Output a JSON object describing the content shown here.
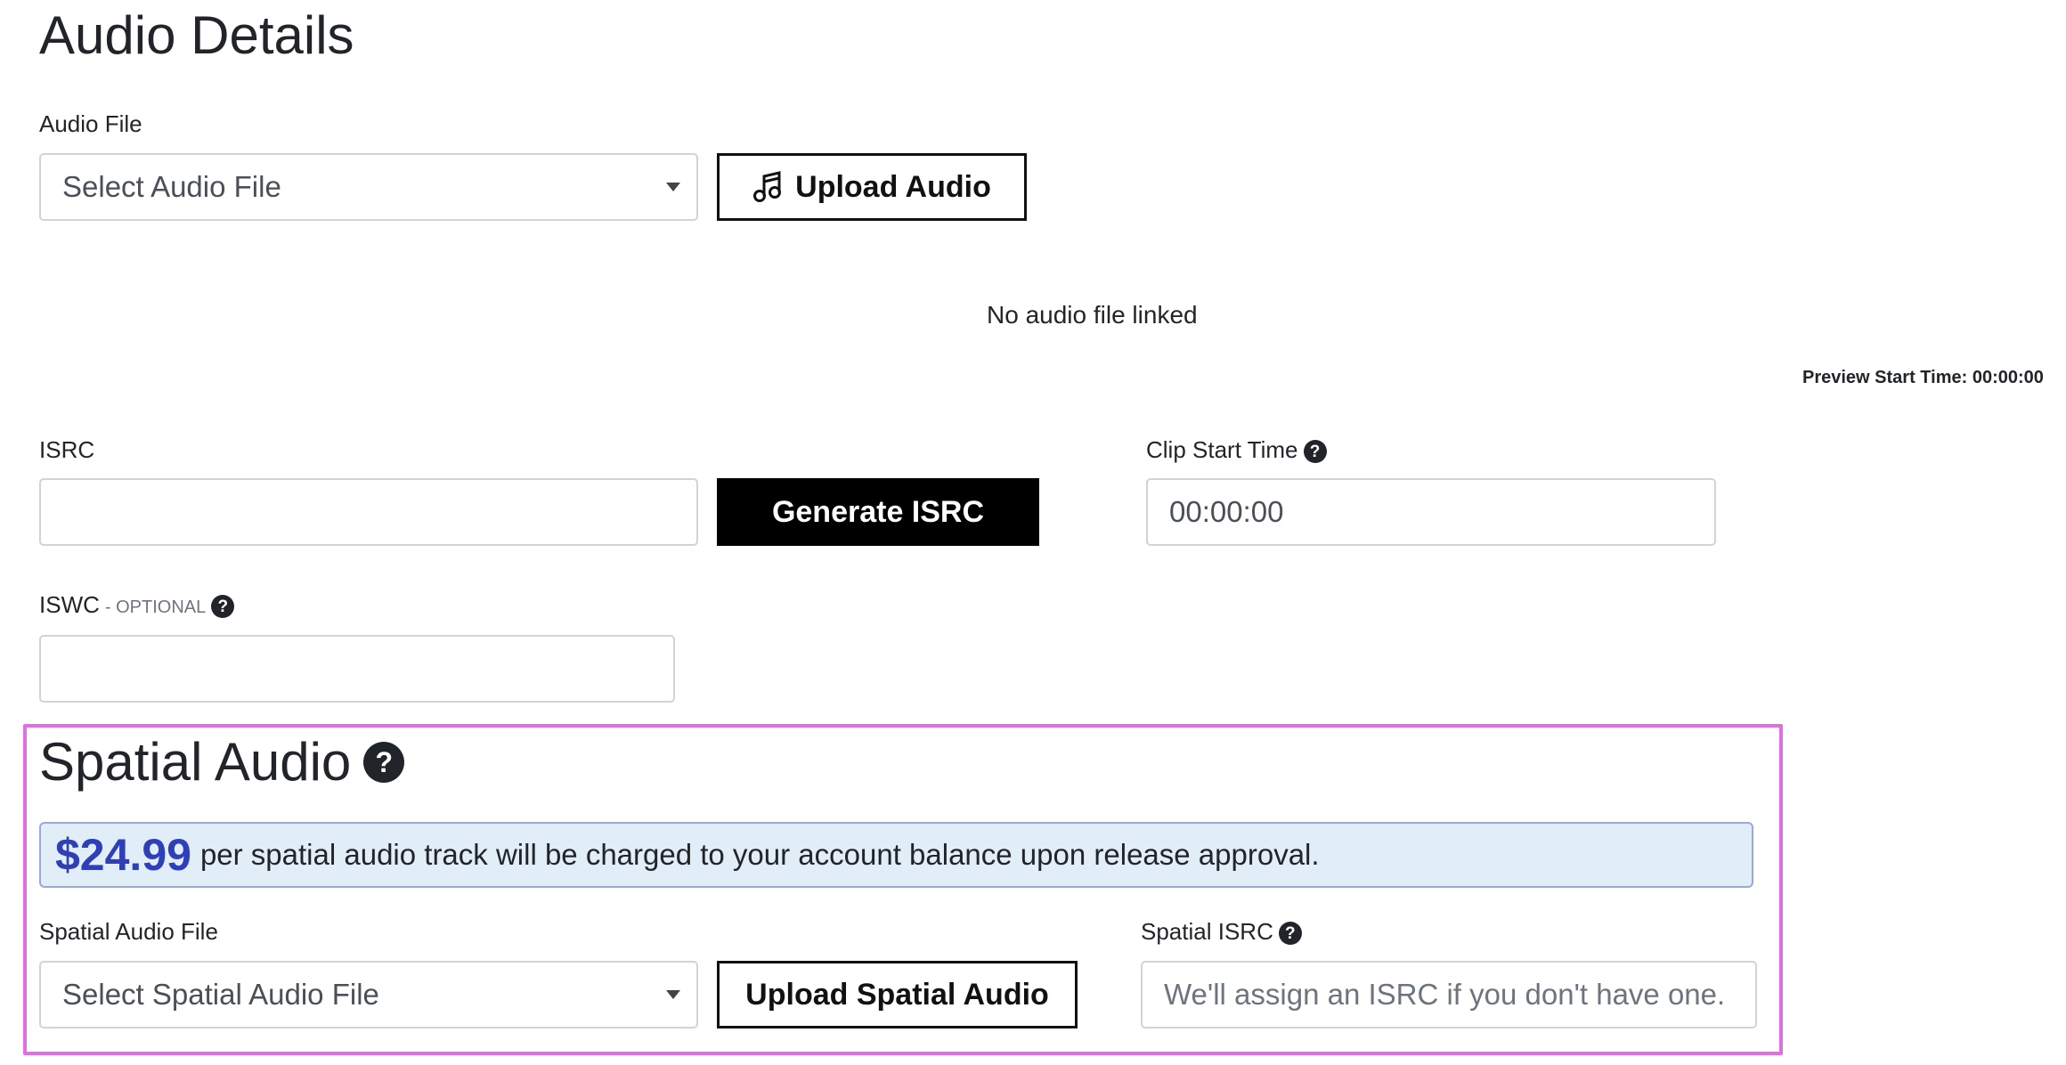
{
  "audio_details": {
    "title": "Audio Details",
    "audio_file_label": "Audio File",
    "audio_select_value": "Select Audio File",
    "upload_audio_label": "Upload Audio",
    "no_audio_text": "No audio file linked",
    "preview_start": "Preview Start Time: 00:00:00",
    "isrc_label": "ISRC",
    "isrc_value": "",
    "generate_isrc_label": "Generate ISRC",
    "clip_start_label": "Clip Start Time",
    "clip_start_value": "00:00:00",
    "iswc_label": "ISWC",
    "iswc_optional": "- OPTIONAL",
    "iswc_value": ""
  },
  "spatial_audio": {
    "title": "Spatial Audio",
    "price": "$24.99",
    "charge_text": "per spatial audio track will be charged to your account balance upon release approval.",
    "file_label": "Spatial Audio File",
    "select_value": "Select Spatial Audio File",
    "upload_label": "Upload Spatial Audio",
    "isrc_label": "Spatial ISRC",
    "isrc_placeholder": "We'll assign an ISRC if you don't have one."
  },
  "icons": {
    "help": "question-circle-icon",
    "music": "music-note-icon",
    "dropdown": "caret-down-icon"
  },
  "colors": {
    "highlight_border": "#e26ee6",
    "price": "#2e3fb8",
    "alert_bg": "#e1eef7",
    "primary_button": "#000000"
  },
  "help_glyph": "?"
}
